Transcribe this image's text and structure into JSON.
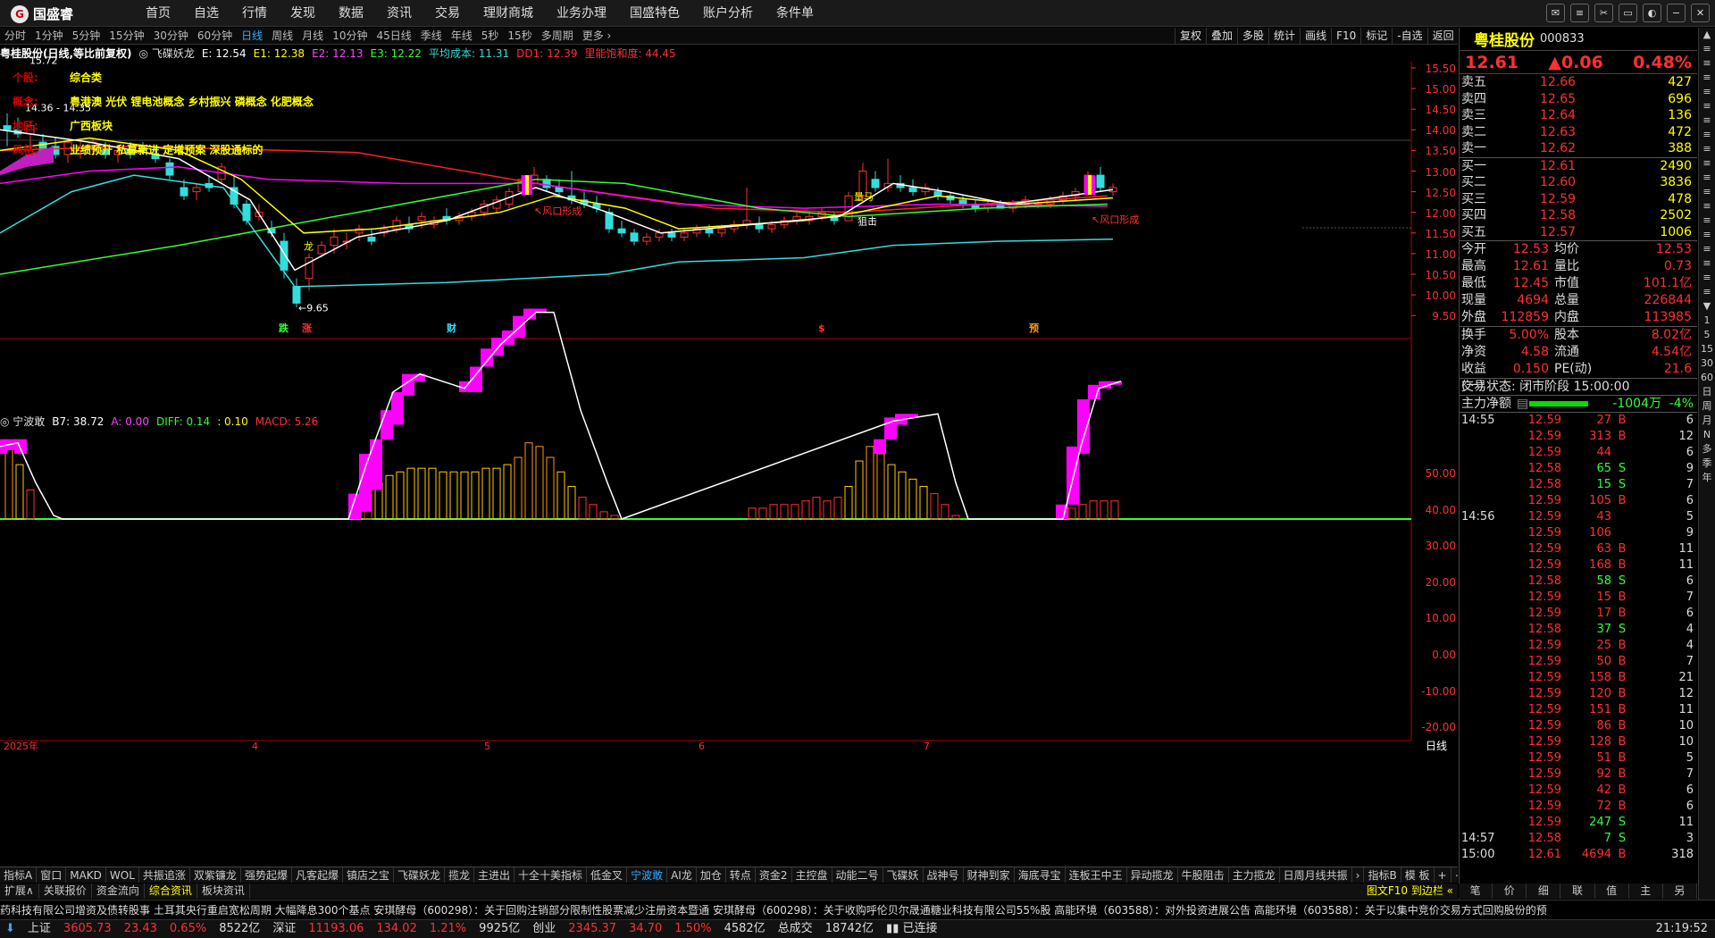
{
  "app": {
    "logo": "国盛睿",
    "menu": [
      "首页",
      "自选",
      "行情",
      "发现",
      "数据",
      "资讯",
      "交易",
      "理财商城",
      "业务办理",
      "国盛特色",
      "账户分析",
      "条件单"
    ],
    "window_icons": [
      "message-icon",
      "menu-icon",
      "share-icon",
      "monitor-icon",
      "skin-icon",
      "minimize-icon",
      "close-icon"
    ]
  },
  "period_bar": {
    "items": [
      "分时",
      "1分钟",
      "5分钟",
      "15分钟",
      "30分钟",
      "60分钟",
      "日线",
      "周线",
      "月线",
      "10分钟",
      "45日线",
      "季线",
      "年线",
      "5秒",
      "15秒",
      "多周期",
      "更多 ›"
    ],
    "active": "日线"
  },
  "tool_buttons": [
    "复权",
    "叠加",
    "多股",
    "统计",
    "画线",
    "F10",
    "标记",
    "-自选",
    "返回"
  ],
  "main_legend": [
    {
      "text": "粤桂股份(日线,等比前复权)",
      "color": "#ffffff"
    },
    {
      "text": "◎ 飞碟妖龙",
      "color": "#dddddd"
    },
    {
      "text": "E: 12.54",
      "color": "#ffffff"
    },
    {
      "text": "E1: 12.38",
      "color": "#ffff00"
    },
    {
      "text": "E2: 12.13",
      "color": "#ff44ff"
    },
    {
      "text": "E3: 12.22",
      "color": "#33ff33"
    },
    {
      "text": "平均成本: 11.31",
      "color": "#33dddd"
    },
    {
      "text": "DD1: 12.39",
      "color": "#ff3030"
    },
    {
      "text": "里能饱和度: 44.45",
      "color": "#ff3030"
    }
  ],
  "info_panel": [
    {
      "key": "个股:",
      "value": "综合类"
    },
    {
      "key": "概念:",
      "value": "粤港澳 光伏 锂电池概念 乡村振兴 磷概念 化肥概念"
    },
    {
      "key": "地区:",
      "value": "广西板块"
    },
    {
      "key": "风格:",
      "value": "业绩预升 私募新进 定增预案 深股通标的"
    }
  ],
  "annotations": {
    "high": "15.72",
    "range": "14.36 - 14.35",
    "low": "←9.65",
    "wind1": "↖风口形成",
    "wind2": "↖风口形成",
    "lb": "量马",
    "dj": "狙击",
    "lon": "龙",
    "ticker_marks": [
      {
        "t": "跌",
        "c": "#33ff33"
      },
      {
        "t": "涨",
        "c": "#ff3030"
      },
      {
        "t": "财",
        "c": "#33ddff"
      },
      {
        "t": "$",
        "c": "#ff3030"
      },
      {
        "t": "预",
        "c": "#ff9900"
      }
    ]
  },
  "main_axis": [
    "15.50",
    "15.00",
    "14.50",
    "14.00",
    "13.50",
    "13.00",
    "12.50",
    "12.00",
    "11.50",
    "11.00",
    "10.50",
    "10.00",
    "9.50"
  ],
  "lower_legend": [
    {
      "text": "◎ 宁波敢",
      "color": "#dddddd"
    },
    {
      "text": "B7: 38.72",
      "color": "#ffffff"
    },
    {
      "text": "A: 0.00",
      "color": "#ff44ff"
    },
    {
      "text": "DIFF: 0.14",
      "color": "#33ff33"
    },
    {
      "text": ": 0.10",
      "color": "#ffff00"
    },
    {
      "text": "MACD: 5.26",
      "color": "#ff3030"
    }
  ],
  "sub_axis": [
    "50.00",
    "40.00",
    "30.00",
    "20.00",
    "10.00",
    "0.00",
    "-10.00",
    "-20.00"
  ],
  "date_axis": [
    {
      "t": "2025年",
      "c": "#ff3030"
    },
    {
      "t": "4"
    },
    {
      "t": "5"
    },
    {
      "t": "6"
    },
    {
      "t": "7"
    }
  ],
  "date_right": "日线",
  "indicator_tabs": [
    "指标A",
    "窗口",
    "MAKD",
    "WOL",
    "共振追涨",
    "双紫镰龙",
    "强势起爆",
    "凡客起爆",
    "镇店之宝",
    "飞碟妖龙",
    "揽龙",
    "主进出",
    "十全十美指标",
    "低金叉",
    "宁波敢",
    "AI龙",
    "加仓",
    "转点",
    "资金2",
    "主控盘",
    "动能二号",
    "飞碟妖",
    "战神号",
    "财神到家",
    "海底寻宝",
    "连板王中王",
    "异动揽龙",
    "牛股阻击",
    "主力揽龙",
    "日周月线共振",
    "›",
    "指标B",
    "模 板",
    "+",
    "−"
  ],
  "indicator_active": "宁波敢",
  "sub_tabs": [
    "扩展∧",
    "关联报价",
    "资金流向",
    "综合资讯",
    "板块资讯"
  ],
  "sub_tabs_active": "综合资讯",
  "sub_tabs_right": "图文F10 到边栏 «",
  "news": "药科技有限公司增资及债转股事  土耳其央行重启宽松周期 大幅降息300个基点    安琪酵母（600298）：关于回购注销部分限制性股票减少注册资本暨通    安琪酵母（600298）：关于收购呼伦贝尔晟通糖业科技有限公司55%股    高能环境（603588）：对外投资进展公告    高能环境（603588）：关于以集中竞价交易方式回购股份的预",
  "status_bar": {
    "items": [
      {
        "name": "上证",
        "v": "3605.73",
        "c": "23.43",
        "p": "0.65%",
        "a": "8522亿"
      },
      {
        "name": "深证",
        "v": "11193.06",
        "c": "134.02",
        "p": "1.21%",
        "a": "9925亿"
      },
      {
        "name": "创业",
        "v": "2345.37",
        "c": "34.70",
        "p": "1.50%",
        "a": "4582亿"
      }
    ],
    "total_label": "总成交",
    "total": "18742亿",
    "conn": "已连接",
    "time": "21:19:52"
  },
  "quote": {
    "name": "粤桂股份",
    "code": "000833",
    "price": "12.61",
    "change": "▲0.06",
    "pct": "0.48%",
    "asks": [
      {
        "l": "卖五",
        "p": "12.66",
        "v": "427"
      },
      {
        "l": "卖四",
        "p": "12.65",
        "v": "696"
      },
      {
        "l": "卖三",
        "p": "12.64",
        "v": "136"
      },
      {
        "l": "卖二",
        "p": "12.63",
        "v": "472"
      },
      {
        "l": "卖一",
        "p": "12.62",
        "v": "388"
      }
    ],
    "bids": [
      {
        "l": "买一",
        "p": "12.61",
        "v": "2490"
      },
      {
        "l": "买二",
        "p": "12.60",
        "v": "3836"
      },
      {
        "l": "买三",
        "p": "12.59",
        "v": "478"
      },
      {
        "l": "买四",
        "p": "12.58",
        "v": "2502"
      },
      {
        "l": "买五",
        "p": "12.57",
        "v": "1006"
      }
    ],
    "stats1": [
      {
        "a": "今开",
        "b": "12.53",
        "a2": "均价",
        "c": "12.53"
      },
      {
        "a": "最高",
        "b": "12.61",
        "a2": "量比",
        "c": "0.73"
      },
      {
        "a": "最低",
        "b": "12.45",
        "a2": "市值",
        "c": "101.1亿"
      },
      {
        "a": "现量",
        "b": "4694",
        "a2": "总量",
        "c": "226844"
      },
      {
        "a": "外盘",
        "b": "112859",
        "a2": "内盘",
        "c": "113985"
      }
    ],
    "stats2": [
      {
        "a": "换手",
        "b": "5.00%",
        "a2": "股本",
        "c": "8.02亿"
      },
      {
        "a": "净资",
        "b": "4.58",
        "a2": "流通",
        "c": "4.54亿"
      },
      {
        "a": "收益(一)",
        "b": "0.150",
        "a2": "PE(动)",
        "c": "21.6"
      }
    ],
    "trade_state": "交易状态: 闭市阶段 15:00:00",
    "main_flow_label": "主力净额",
    "main_flow": "-1004万",
    "main_flow_pct": "-4%",
    "ticks": [
      {
        "t": "14:55",
        "p": "12.59",
        "v": "27",
        "s": "B",
        "n": "6"
      },
      {
        "t": "",
        "p": "12.59",
        "v": "313",
        "s": "B",
        "n": "12"
      },
      {
        "t": "",
        "p": "12.59",
        "v": "44",
        "s": "",
        "n": "6"
      },
      {
        "t": "",
        "p": "12.58",
        "v": "65",
        "s": "S",
        "n": "9"
      },
      {
        "t": "",
        "p": "12.58",
        "v": "15",
        "s": "S",
        "n": "7"
      },
      {
        "t": "",
        "p": "12.59",
        "v": "105",
        "s": "B",
        "n": "6"
      },
      {
        "t": "14:56",
        "p": "12.59",
        "v": "43",
        "s": "",
        "n": "5"
      },
      {
        "t": "",
        "p": "12.59",
        "v": "106",
        "s": "",
        "n": "9"
      },
      {
        "t": "",
        "p": "12.59",
        "v": "63",
        "s": "B",
        "n": "11"
      },
      {
        "t": "",
        "p": "12.59",
        "v": "168",
        "s": "B",
        "n": "11"
      },
      {
        "t": "",
        "p": "12.58",
        "v": "58",
        "s": "S",
        "n": "6"
      },
      {
        "t": "",
        "p": "12.59",
        "v": "15",
        "s": "B",
        "n": "7"
      },
      {
        "t": "",
        "p": "12.59",
        "v": "17",
        "s": "B",
        "n": "6"
      },
      {
        "t": "",
        "p": "12.58",
        "v": "37",
        "s": "S",
        "n": "4"
      },
      {
        "t": "",
        "p": "12.59",
        "v": "25",
        "s": "B",
        "n": "4"
      },
      {
        "t": "",
        "p": "12.59",
        "v": "50",
        "s": "B",
        "n": "7"
      },
      {
        "t": "",
        "p": "12.59",
        "v": "158",
        "s": "B",
        "n": "21"
      },
      {
        "t": "",
        "p": "12.59",
        "v": "120",
        "s": "B",
        "n": "12"
      },
      {
        "t": "",
        "p": "12.59",
        "v": "151",
        "s": "B",
        "n": "11"
      },
      {
        "t": "",
        "p": "12.59",
        "v": "86",
        "s": "B",
        "n": "10"
      },
      {
        "t": "",
        "p": "12.59",
        "v": "128",
        "s": "B",
        "n": "10"
      },
      {
        "t": "",
        "p": "12.59",
        "v": "51",
        "s": "B",
        "n": "5"
      },
      {
        "t": "",
        "p": "12.59",
        "v": "92",
        "s": "B",
        "n": "7"
      },
      {
        "t": "",
        "p": "12.59",
        "v": "42",
        "s": "B",
        "n": "6"
      },
      {
        "t": "",
        "p": "12.59",
        "v": "72",
        "s": "B",
        "n": "6"
      },
      {
        "t": "",
        "p": "12.59",
        "v": "247",
        "s": "S",
        "n": "11"
      },
      {
        "t": "14:57",
        "p": "12.58",
        "v": "7",
        "s": "S",
        "n": "3"
      },
      {
        "t": "15:00",
        "p": "12.61",
        "v": "4694",
        "s": "B",
        "n": "318"
      }
    ],
    "bottom_tabs": [
      "笔",
      "价",
      "细",
      "联",
      "值",
      "主",
      "另"
    ]
  },
  "sidebar": [
    "▲",
    "≡",
    "≡",
    "≡",
    "≡",
    "≡",
    "≡",
    "≡",
    "≡",
    "≡",
    "≡",
    "≡",
    "≡",
    "≡",
    "≡",
    "≡",
    "≡",
    "≡",
    "≡",
    "▼",
    "1",
    "5",
    "15",
    "30",
    "60",
    "日",
    "周",
    "月",
    "N",
    "多",
    "季",
    "年"
  ],
  "colors": {
    "up": "#ff3030",
    "down": "#33dddd",
    "magenta": "#ff00ff",
    "white": "#ffffff",
    "yellow": "#ffff00",
    "green": "#33ff33",
    "cyan": "#33dddd",
    "red": "#ff2020"
  }
}
